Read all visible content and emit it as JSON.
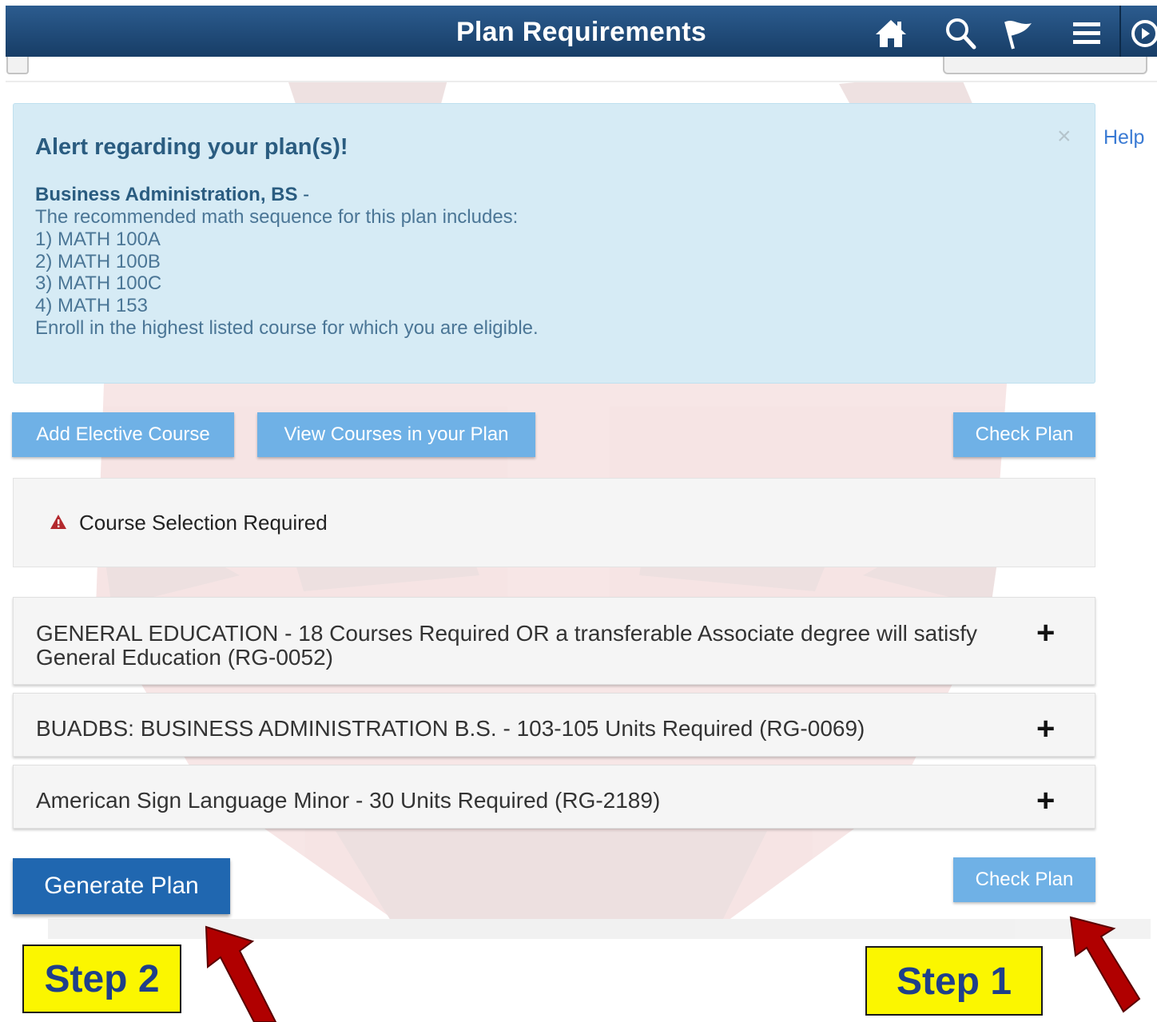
{
  "header": {
    "title": "Plan Requirements",
    "icons": [
      "home-icon",
      "search-icon",
      "flag-icon",
      "menu-icon",
      "navbar-icon"
    ]
  },
  "alert": {
    "title": "Alert regarding your plan(s)!",
    "plan_name": "Business Administration, BS",
    "plan_dash": " -",
    "lines": [
      "The recommended math sequence for this plan includes:",
      "1) MATH 100A",
      "2) MATH 100B",
      "3) MATH 100C",
      "4) MATH 153",
      "Enroll in the highest listed course for which you are eligible."
    ],
    "close_glyph": "×"
  },
  "help_label": "Help",
  "buttons": {
    "add_elective": "Add Elective Course",
    "view_courses": "View Courses in your Plan",
    "check_plan_top": "Check Plan",
    "generate_plan": "Generate Plan",
    "check_plan_bottom": "Check Plan"
  },
  "course_selection": {
    "message": "Course Selection Required"
  },
  "requirements": [
    {
      "label": "GENERAL EDUCATION - 18 Courses Required OR a transferable Associate degree will satisfy General Education (RG-0052)",
      "expand": "+"
    },
    {
      "label": "BUADBS: BUSINESS ADMINISTRATION B.S. - 103-105 Units Required (RG-0069)",
      "expand": "+"
    },
    {
      "label": "American Sign Language Minor - 30 Units Required (RG-2189)",
      "expand": "+"
    }
  ],
  "steps": {
    "step2": "Step 2",
    "step1": "Step 1"
  },
  "colors": {
    "header": "#1f4b7a",
    "alert_bg": "#d6ebf5",
    "button_light": "#6fb1e6",
    "button_dark": "#2067b0",
    "step_bg": "#fbf600",
    "arrow": "#b30000"
  }
}
